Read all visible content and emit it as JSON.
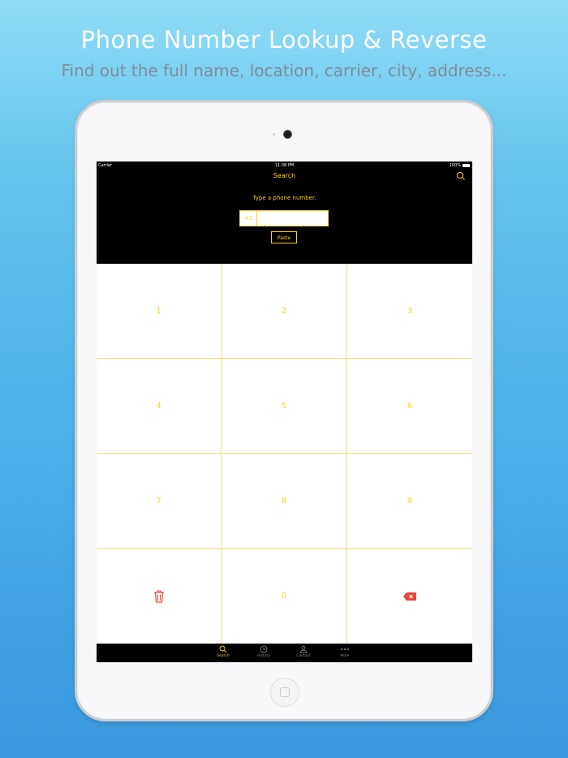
{
  "promo": {
    "headline": "Phone Number Lookup & Reverse",
    "subline": "Find out the full name, location, carrier, city, address..."
  },
  "status_bar": {
    "carrier": "Carrier",
    "time": "11:38 PM",
    "battery": "100%"
  },
  "nav": {
    "title": "Search"
  },
  "search": {
    "prompt": "Type a phone number.",
    "country_code": "+1",
    "phone_value": "",
    "paste_label": "Paste"
  },
  "keypad": {
    "keys": [
      "1",
      "2",
      "3",
      "4",
      "5",
      "6",
      "7",
      "8",
      "9",
      "0"
    ]
  },
  "tabs": [
    {
      "label": "Search",
      "icon": "search-icon",
      "active": true
    },
    {
      "label": "History",
      "icon": "clock-icon",
      "active": false
    },
    {
      "label": "Contact",
      "icon": "person-icon",
      "active": false
    },
    {
      "label": "More",
      "icon": "more-icon",
      "active": false
    }
  ],
  "colors": {
    "accent": "#ffd21a",
    "delete_red": "#e8463a",
    "header_bg": "#000000"
  }
}
